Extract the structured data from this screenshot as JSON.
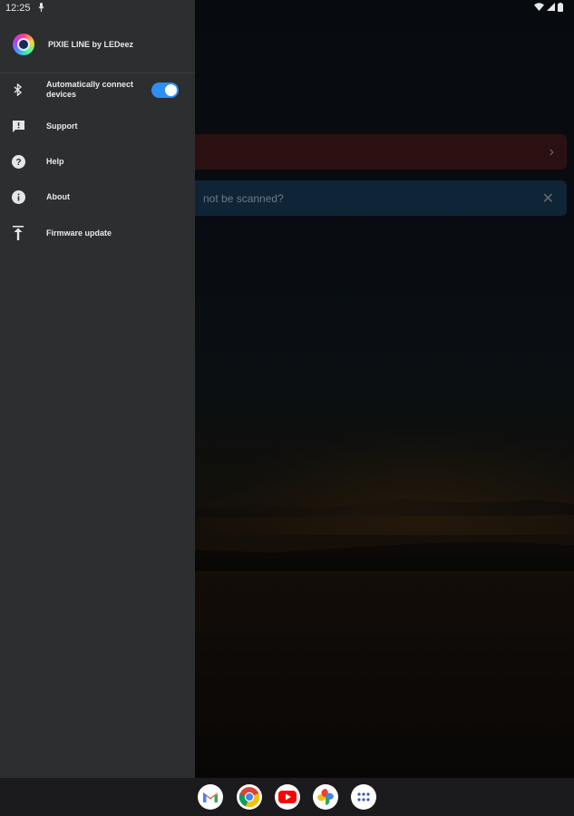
{
  "status_bar": {
    "time": "12:25"
  },
  "drawer": {
    "app_name": "PIXIE LINE by LEDeez",
    "items": [
      {
        "label": "Automatically connect\ndevices",
        "icon": "bluetooth-icon"
      },
      {
        "label": "Support",
        "icon": "feedback-icon"
      },
      {
        "label": "Help",
        "icon": "help-icon"
      },
      {
        "label": "About",
        "icon": "info-icon"
      },
      {
        "label": "Firmware update",
        "icon": "upload-icon"
      }
    ],
    "toggle_on": true
  },
  "background_cards": {
    "alert_text": "",
    "info_text": "not be scanned?"
  },
  "dock": {
    "apps": [
      "gmail-icon",
      "chrome-icon",
      "youtube-icon",
      "photos-icon",
      "app-drawer-icon"
    ]
  },
  "colors": {
    "drawer_bg": "#2d2e30",
    "toggle": "#2f8ff0",
    "alert_card": "#3a1618",
    "info_card": "#16304a"
  }
}
